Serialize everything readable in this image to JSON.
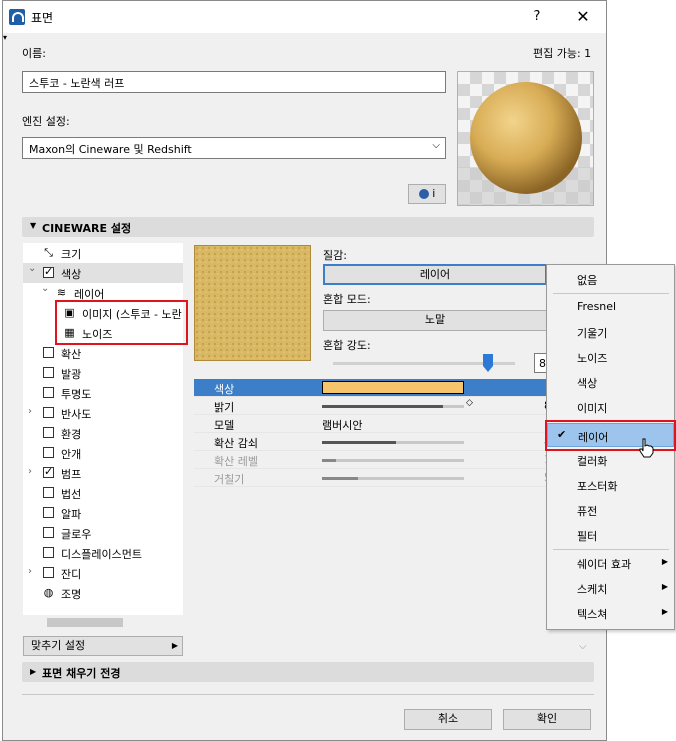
{
  "window": {
    "title": "표면",
    "help": "?",
    "close": "✕"
  },
  "name_section": {
    "label": "이름:",
    "edit_label": "편집 가능: 1",
    "value": "스투코 - 노란색 러프"
  },
  "engine": {
    "label": "엔진 설정:",
    "value": "Maxon의 Cineware 및 Redshift",
    "info_btn": "i"
  },
  "cineware": {
    "title": "CINEWARE 설정"
  },
  "tree": {
    "items": [
      {
        "label": "크기",
        "icon": "resize-icon",
        "checkbox": false
      },
      {
        "label": "색상",
        "checked": true,
        "expanded": true,
        "selected": true
      },
      {
        "label": "레이어",
        "icon": "layers-icon",
        "expanded": true
      },
      {
        "label": "이미지 (스투코 - 노란",
        "icon": "image-icon"
      },
      {
        "label": "노이즈",
        "icon": "noise-icon"
      },
      {
        "label": "확산",
        "checked": false
      },
      {
        "label": "발광",
        "checked": false
      },
      {
        "label": "투명도",
        "checked": false
      },
      {
        "label": "반사도",
        "checked": false,
        "expandable": true
      },
      {
        "label": "환경",
        "checked": false
      },
      {
        "label": "안개",
        "checked": false
      },
      {
        "label": "범프",
        "checked": true,
        "expandable": true
      },
      {
        "label": "법선",
        "checked": false
      },
      {
        "label": "알파",
        "checked": false
      },
      {
        "label": "글로우",
        "checked": false
      },
      {
        "label": "디스플레이스먼트",
        "checked": false
      },
      {
        "label": "잔디",
        "checked": false,
        "expandable": true
      },
      {
        "label": "조명",
        "icon": "light-icon"
      }
    ],
    "fit_button": "맞추기 설정"
  },
  "texture": {
    "label": "질감:",
    "texture_value": "레이어",
    "blend_mode_label": "혼합 모드:",
    "blend_mode_value": "노말",
    "blend_strength_label": "혼합 강도:",
    "blend_strength_value": "87",
    "blend_strength_level": 0.85
  },
  "properties": [
    {
      "name": "색상",
      "kind": "color",
      "color": "#f6c46a",
      "header": true
    },
    {
      "name": "밝기",
      "kind": "bar",
      "level": 0.85,
      "right": "8"
    },
    {
      "name": "모델",
      "kind": "text",
      "value": "램버시안"
    },
    {
      "name": "확산 감쇠",
      "kind": "bar",
      "level": 0.52,
      "right": "8"
    },
    {
      "name": "확산 레벨",
      "kind": "bar",
      "level": 0.1,
      "right": "10",
      "disabled": true
    },
    {
      "name": "거칠기",
      "kind": "bar",
      "level": 0.25,
      "right": "5",
      "disabled": true
    }
  ],
  "menu": {
    "items": [
      {
        "label": "없음"
      },
      {
        "sep": true
      },
      {
        "label": "Fresnel"
      },
      {
        "label": "기울기"
      },
      {
        "label": "노이즈"
      },
      {
        "label": "색상"
      },
      {
        "label": "이미지"
      },
      {
        "sep": true
      },
      {
        "label": "레이어",
        "checked": true,
        "highlight": true
      },
      {
        "label": "컬러화"
      },
      {
        "label": "포스터화"
      },
      {
        "label": "퓨전"
      },
      {
        "label": "필터"
      },
      {
        "sep": true
      },
      {
        "label": "쉐이더 효과",
        "submenu": true
      },
      {
        "label": "스케치",
        "submenu": true
      },
      {
        "label": "텍스쳐",
        "submenu": true
      }
    ]
  },
  "fill_section": {
    "title": "표면 채우기 전경"
  },
  "buttons": {
    "cancel": "취소",
    "ok": "확인"
  }
}
